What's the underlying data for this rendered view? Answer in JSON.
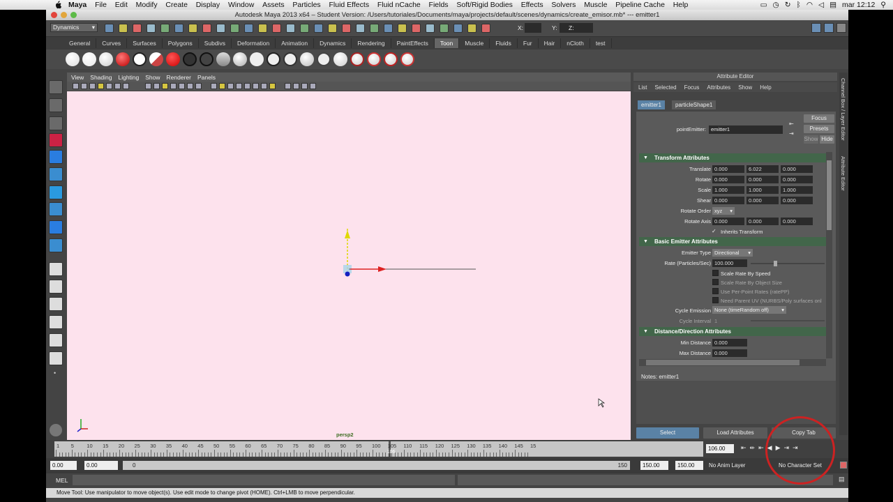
{
  "menubar": {
    "app": "Maya",
    "items": [
      "File",
      "Edit",
      "Modify",
      "Create",
      "Display",
      "Window",
      "Assets",
      "Particles",
      "Fluid Effects",
      "Fluid nCache",
      "Fields",
      "Soft/Rigid Bodies",
      "Effects",
      "Solvers",
      "Muscle",
      "Pipeline Cache",
      "Help"
    ],
    "clock": "mar 12:12"
  },
  "window": {
    "title": "Autodesk Maya 2013 x64 – Student Version: /Users/tutoriales/Documents/maya/projects/default/scenes/dynamics/create_emisor.mb*   ---   emitter1"
  },
  "statusline": {
    "menuset": "Dynamics",
    "x_label": "X:",
    "y_label": "Y:",
    "z_label": "Z:"
  },
  "shelf": {
    "tabs": [
      "General",
      "Curves",
      "Surfaces",
      "Polygons",
      "Subdivs",
      "Deformation",
      "Animation",
      "Dynamics",
      "Rendering",
      "PaintEffects",
      "Toon",
      "Muscle",
      "Fluids",
      "Fur",
      "Hair",
      "nCloth",
      "test"
    ],
    "active_tab": "Toon"
  },
  "viewport": {
    "menu": [
      "View",
      "Shading",
      "Lighting",
      "Show",
      "Renderer",
      "Panels"
    ],
    "camera": "persp2"
  },
  "attribute_editor": {
    "title": "Attribute Editor",
    "menu": [
      "List",
      "Selected",
      "Focus",
      "Attributes",
      "Show",
      "Help"
    ],
    "tabs": [
      "emitter1",
      "particleShape1"
    ],
    "node_label": "pointEmitter:",
    "node_name": "emitter1",
    "focus": "Focus",
    "presets": "Presets",
    "show": "Show",
    "hide": "Hide",
    "side_tabs": [
      "Channel Box / Layer Editor",
      "Attribute Editor"
    ],
    "transform": {
      "header": "Transform Attributes",
      "translate": {
        "label": "Translate",
        "v": [
          "0.000",
          "6.022",
          "0.000"
        ]
      },
      "rotate": {
        "label": "Rotate",
        "v": [
          "0.000",
          "0.000",
          "0.000"
        ]
      },
      "scale": {
        "label": "Scale",
        "v": [
          "1.000",
          "1.000",
          "1.000"
        ]
      },
      "shear": {
        "label": "Shear",
        "v": [
          "0.000",
          "0.000",
          "0.000"
        ]
      },
      "rotate_order_label": "Rotate Order",
      "rotate_order": "xyz",
      "rotate_axis": {
        "label": "Rotate Axis",
        "v": [
          "0.000",
          "0.000",
          "0.000"
        ]
      },
      "inherits": "Inherits Transform"
    },
    "emitter": {
      "header": "Basic Emitter Attributes",
      "type_label": "Emitter Type",
      "type": "Directional",
      "rate_label": "Rate (Particles/Sec)",
      "rate": "100.000",
      "rate_fraction": 0.33,
      "scale_speed": "Scale Rate By Speed",
      "scale_size": "Scale Rate By Object Size",
      "per_point": "Use Per-Point Rates (ratePP)",
      "need_uv": "Need Parent UV (NURBS/Poly surfaces onl",
      "cycle_label": "Cycle Emission",
      "cycle": "None (timeRandom off)",
      "interval_label": "Cycle Interval",
      "interval": "1"
    },
    "distance": {
      "header": "Distance/Direction Attributes",
      "min_label": "Min Distance",
      "min": "0.000",
      "max_label": "Max Distance",
      "max": "0.000"
    },
    "notes": "Notes:  emitter1",
    "buttons": {
      "select": "Select",
      "load": "Load Attributes",
      "copy": "Copy Tab"
    }
  },
  "timeline": {
    "ticks": [
      "1",
      "5",
      "10",
      "15",
      "20",
      "25",
      "30",
      "35",
      "40",
      "45",
      "50",
      "55",
      "60",
      "65",
      "70",
      "75",
      "80",
      "85",
      "90",
      "95",
      "100",
      "105",
      "110",
      "115",
      "120",
      "125",
      "130",
      "135",
      "140",
      "145",
      "15"
    ],
    "current_frame": "106",
    "current_field": "106.00"
  },
  "range": {
    "start": "0.00",
    "start2": "0.00",
    "bar_start": "0",
    "bar_end": "150",
    "end": "150.00",
    "end2": "150.00",
    "anim_layer": "No Anim Layer",
    "char_set": "No Character Set"
  },
  "cmdline": {
    "label": "MEL"
  },
  "helpline": {
    "text": "Move Tool: Use manipulator to move object(s). Use edit mode to change pivot (HOME).  Ctrl+LMB to move perpendicular."
  }
}
